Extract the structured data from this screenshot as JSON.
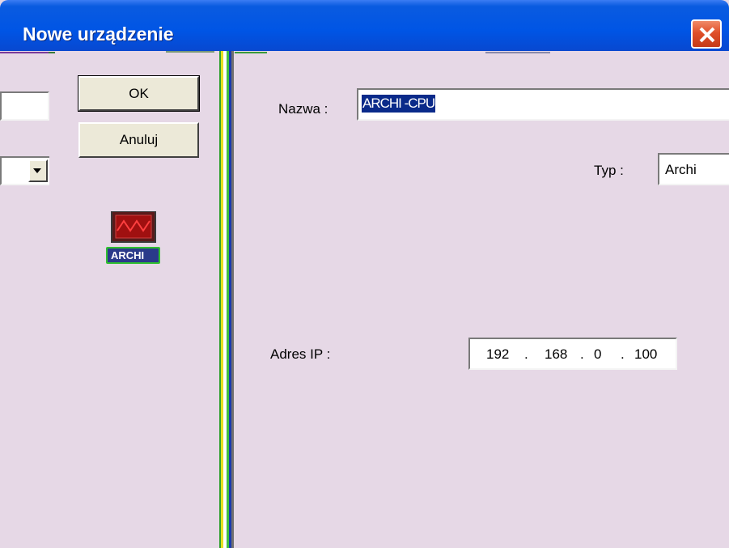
{
  "window": {
    "title": "Nowe urządzenie"
  },
  "buttons": {
    "ok": "OK",
    "cancel": "Anuluj"
  },
  "device": {
    "icon_label": "ARCHI"
  },
  "form": {
    "name_label": "Nazwa :",
    "name_value": "ARCHI -CPU",
    "type_label": "Typ :",
    "type_value": "Archi",
    "ip_label": "Adres IP :",
    "ip_octets": [
      "192",
      "168",
      "0",
      "100"
    ]
  },
  "colors": {
    "title_bar": "#0055e5",
    "dialog_bg": "#e6d8e6",
    "close_button": "#e0502a",
    "selection": "#0a2a8a"
  }
}
